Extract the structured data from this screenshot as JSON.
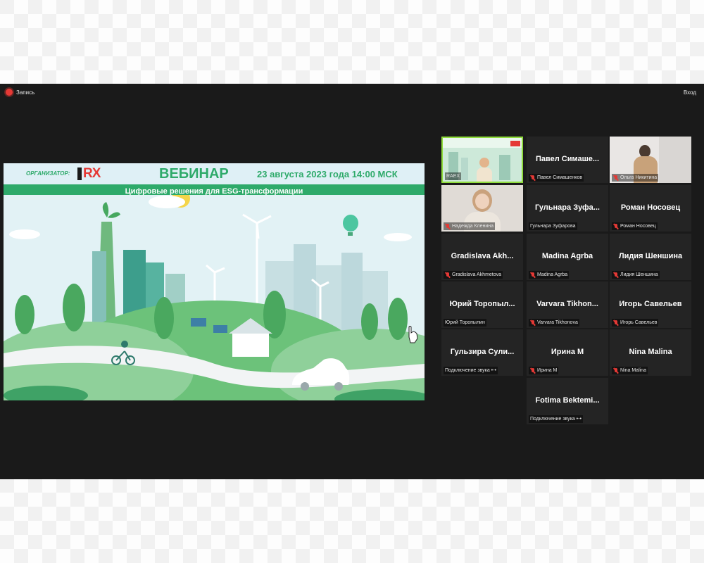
{
  "topbar": {
    "recording_label": "Запись",
    "exit_label": "Вход"
  },
  "slide": {
    "organizer_label": "ОРГАНИЗАТОР:",
    "logo_text": "RX",
    "title": "ВЕБИНАР",
    "date": "23 августа 2023 года 14:00 МСК",
    "subtitle": "Цифровые решения для ESG-трансформации"
  },
  "participants": [
    {
      "big": "",
      "small": "RAEX",
      "muted": false,
      "video": "raex"
    },
    {
      "big": "Павел Симаше...",
      "small": "Павел Симашенков",
      "muted": true,
      "video": ""
    },
    {
      "big": "",
      "small": "Ольга Никитина",
      "muted": true,
      "video": "olga"
    },
    {
      "big": "",
      "small": "Надежда Кленина",
      "muted": true,
      "video": "nadya"
    },
    {
      "big": "Гульнара Зуфа...",
      "small": "Гульнара Зуфарова",
      "muted": false,
      "video": ""
    },
    {
      "big": "Роман Носовец",
      "small": "Роман Носовец",
      "muted": true,
      "video": ""
    },
    {
      "big": "Gradislava Akh...",
      "small": "Gradislava Akhmetova",
      "muted": true,
      "video": ""
    },
    {
      "big": "Madina Agrba",
      "small": "Madina Agrba",
      "muted": true,
      "video": ""
    },
    {
      "big": "Лидия Шеншина",
      "small": "Лидия Шеншина",
      "muted": true,
      "video": ""
    },
    {
      "big": "Юрий Торопыл...",
      "small": "Юрий Торопылин",
      "muted": false,
      "video": ""
    },
    {
      "big": "Varvara Tikhon...",
      "small": "Varvara Tikhonova",
      "muted": true,
      "video": ""
    },
    {
      "big": "Игорь Савельев",
      "small": "Игорь Савельев",
      "muted": true,
      "video": ""
    },
    {
      "big": "Гульзира Сули...",
      "small": "Подключение звука  •-•",
      "muted": false,
      "video": ""
    },
    {
      "big": "Ирина М",
      "small": "Ирина М",
      "muted": true,
      "video": ""
    },
    {
      "big": "Nina Malina",
      "small": "Nina Malina",
      "muted": true,
      "video": ""
    },
    {
      "big": "Fotima Bektemi...",
      "small": "Подключение звука  •-•",
      "muted": false,
      "video": ""
    }
  ],
  "colors": {
    "accent_green": "#2eaa6a",
    "recording_red": "#e53935",
    "active_speaker_border": "#8fdc3c"
  },
  "icons": {
    "recording": "record-dot-icon",
    "muted": "mic-off-icon",
    "cursor": "hand-cursor-icon"
  }
}
